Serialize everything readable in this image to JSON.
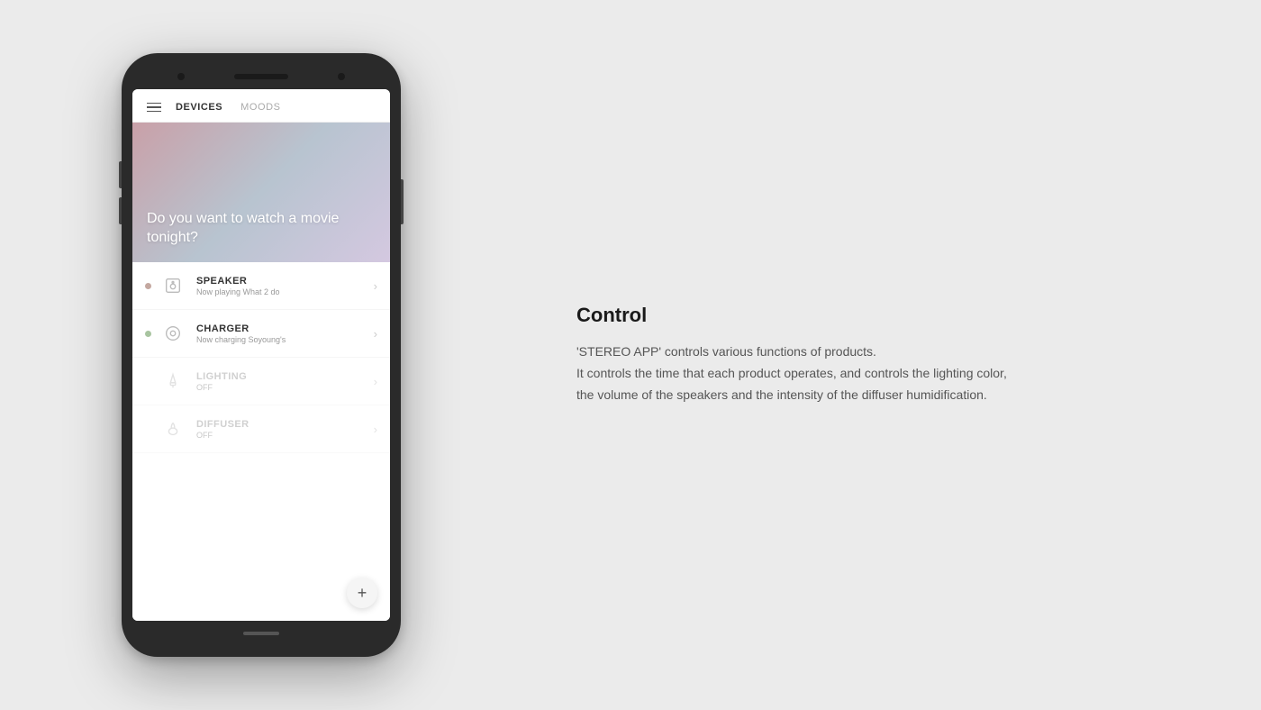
{
  "app": {
    "nav": {
      "devices_label": "DEVICES",
      "moods_label": "MOODS"
    },
    "hero": {
      "text": "Do you want to watch a movie tonight?"
    },
    "devices": [
      {
        "id": "speaker",
        "name": "SPEAKER",
        "status": "Now playing What 2 do",
        "active": true,
        "icon": "speaker"
      },
      {
        "id": "charger",
        "name": "CHARGER",
        "status": "Now charging Soyoung's",
        "active": true,
        "icon": "charger"
      },
      {
        "id": "lighting",
        "name": "LIGHTING",
        "status": "OFF",
        "active": false,
        "icon": "lighting"
      },
      {
        "id": "diffuser",
        "name": "DIFFUSER",
        "status": "OFF",
        "active": false,
        "icon": "diffuser"
      }
    ],
    "fab_label": "+"
  },
  "panel": {
    "title": "Control",
    "description_line1": "'STEREO APP' controls various functions of products.",
    "description_line2": "It controls the time that each product operates, and controls the lighting color,",
    "description_line3": "the volume of the speakers and the intensity of the diffuser humidification."
  }
}
